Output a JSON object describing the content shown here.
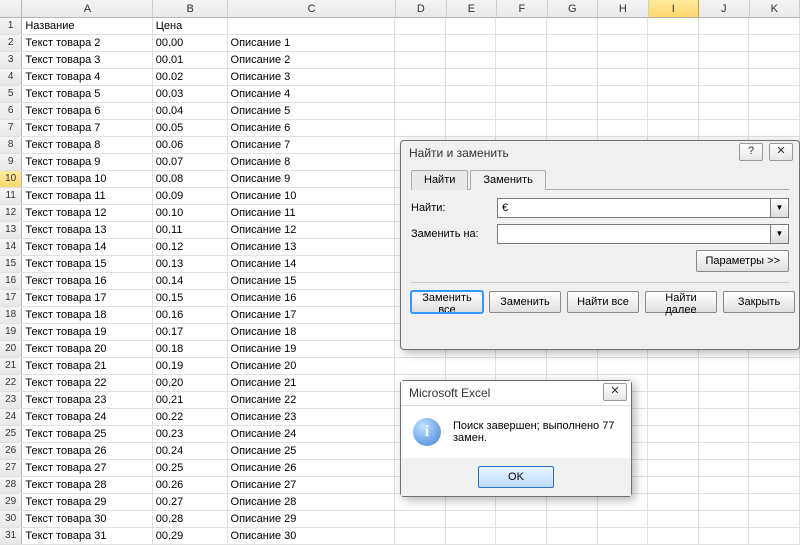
{
  "columns": [
    "A",
    "B",
    "C",
    "D",
    "E",
    "F",
    "G",
    "H",
    "I",
    "J",
    "K"
  ],
  "selected_col": "I",
  "selected_row": 10,
  "header": {
    "A": "Название",
    "B": "Цена",
    "C": ""
  },
  "rows": [
    {
      "n": 2,
      "a": "Текст товара 2",
      "b": "00.00",
      "c": "Описание 1"
    },
    {
      "n": 3,
      "a": "Текст товара 3",
      "b": "00.01",
      "c": "Описание 2"
    },
    {
      "n": 4,
      "a": "Текст товара 4",
      "b": "00.02",
      "c": "Описание 3"
    },
    {
      "n": 5,
      "a": "Текст товара 5",
      "b": "00.03",
      "c": "Описание 4"
    },
    {
      "n": 6,
      "a": "Текст товара 6",
      "b": "00.04",
      "c": "Описание 5"
    },
    {
      "n": 7,
      "a": "Текст товара 7",
      "b": "00.05",
      "c": "Описание 6"
    },
    {
      "n": 8,
      "a": "Текст товара 8",
      "b": "00.06",
      "c": "Описание 7"
    },
    {
      "n": 9,
      "a": "Текст товара 9",
      "b": "00.07",
      "c": "Описание 8"
    },
    {
      "n": 10,
      "a": "Текст товара 10",
      "b": "00.08",
      "c": "Описание 9"
    },
    {
      "n": 11,
      "a": "Текст товара 11",
      "b": "00.09",
      "c": "Описание 10"
    },
    {
      "n": 12,
      "a": "Текст товара 12",
      "b": "00.10",
      "c": "Описание 11"
    },
    {
      "n": 13,
      "a": "Текст товара 13",
      "b": "00.11",
      "c": "Описание 12"
    },
    {
      "n": 14,
      "a": "Текст товара 14",
      "b": "00.12",
      "c": "Описание 13"
    },
    {
      "n": 15,
      "a": "Текст товара 15",
      "b": "00.13",
      "c": "Описание 14"
    },
    {
      "n": 16,
      "a": "Текст товара 16",
      "b": "00.14",
      "c": "Описание 15"
    },
    {
      "n": 17,
      "a": "Текст товара 17",
      "b": "00.15",
      "c": "Описание 16"
    },
    {
      "n": 18,
      "a": "Текст товара 18",
      "b": "00.16",
      "c": "Описание 17"
    },
    {
      "n": 19,
      "a": "Текст товара 19",
      "b": "00.17",
      "c": "Описание 18"
    },
    {
      "n": 20,
      "a": "Текст товара 20",
      "b": "00.18",
      "c": "Описание 19"
    },
    {
      "n": 21,
      "a": "Текст товара 21",
      "b": "00.19",
      "c": "Описание 20"
    },
    {
      "n": 22,
      "a": "Текст товара 22",
      "b": "00.20",
      "c": "Описание 21"
    },
    {
      "n": 23,
      "a": "Текст товара 23",
      "b": "00.21",
      "c": "Описание 22"
    },
    {
      "n": 24,
      "a": "Текст товара 24",
      "b": "00.22",
      "c": "Описание 23"
    },
    {
      "n": 25,
      "a": "Текст товара 25",
      "b": "00.23",
      "c": "Описание 24"
    },
    {
      "n": 26,
      "a": "Текст товара 26",
      "b": "00.24",
      "c": "Описание 25"
    },
    {
      "n": 27,
      "a": "Текст товара 27",
      "b": "00.25",
      "c": "Описание 26"
    },
    {
      "n": 28,
      "a": "Текст товара 28",
      "b": "00.26",
      "c": "Описание 27"
    },
    {
      "n": 29,
      "a": "Текст товара 29",
      "b": "00.27",
      "c": "Описание 28"
    },
    {
      "n": 30,
      "a": "Текст товара 30",
      "b": "00.28",
      "c": "Описание 29"
    },
    {
      "n": 31,
      "a": "Текст товара 31",
      "b": "00.29",
      "c": "Описание 30"
    }
  ],
  "fr": {
    "title": "Найти и заменить",
    "tab_find": "Найти",
    "tab_replace": "Заменить",
    "find_label": "Найти:",
    "find_value": "€",
    "replace_label": "Заменить на:",
    "replace_value": "",
    "params": "Параметры >>",
    "btn_replace_all": "Заменить все",
    "btn_replace": "Заменить",
    "btn_find_all": "Найти все",
    "btn_find_next": "Найти далее",
    "btn_close": "Закрыть",
    "help_glyph": "?",
    "close_glyph": "✕"
  },
  "msg": {
    "title": "Microsoft Excel",
    "text": "Поиск завершен; выполнено 77 замен.",
    "ok": "OK",
    "close_glyph": "✕"
  }
}
